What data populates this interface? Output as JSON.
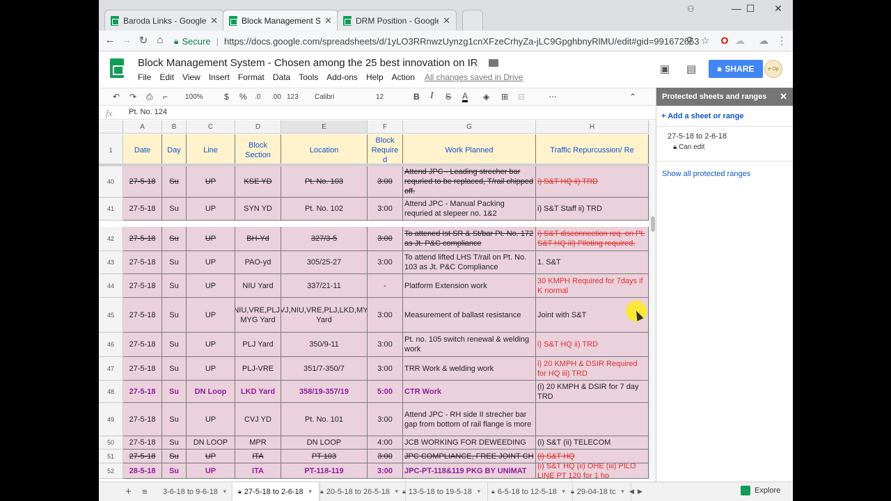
{
  "browser": {
    "tabs": [
      {
        "label": "Baroda Links - Google Sh",
        "active": false
      },
      {
        "label": "Block Management Syste",
        "active": true
      },
      {
        "label": "DRM Position - Google Sh",
        "active": false
      }
    ],
    "secure_label": "Secure",
    "url": "https://docs.google.com/spreadsheets/d/1yLO3RRnwzUynzg1cnXFzeCrhyZa-jLC9GpghbnyRlMU/edit#gid=991672653",
    "accent": "#4285f4"
  },
  "doc": {
    "title": "Block Management System - Chosen among the 25 best innovation on IR",
    "menu": [
      "File",
      "Edit",
      "View",
      "Insert",
      "Format",
      "Data",
      "Tools",
      "Add-ons",
      "Help",
      "Action"
    ],
    "saved_status": "All changes saved in Drive",
    "share_label": "SHARE",
    "avatar_text": "e-Op"
  },
  "format_toolbar": {
    "zoom": "100%",
    "currency": "$",
    "percent": "%",
    "dec_less": ".0",
    "dec_more": ".00",
    "number_format": "123",
    "font": "Calibri",
    "font_size": "12"
  },
  "formula_bar": {
    "value": "Pt. No. 124"
  },
  "columns": [
    "A",
    "B",
    "C",
    "D",
    "E",
    "F",
    "G",
    "H"
  ],
  "header_row": {
    "number": "1",
    "cells": [
      "Date",
      "Day",
      "Line",
      "Block Section",
      "Location",
      "Block Require d",
      "Work Planned",
      "Traffic Repurcussion/ Re"
    ]
  },
  "rows": [
    {
      "num": "40",
      "style": "strike",
      "cells": [
        "27-5-18",
        "Su",
        "UP",
        "KSE YD",
        "Pt. No. 103",
        "3:00",
        "Attend JPC - Leading strecher bar requried to be replaced, T/rail chipped off.",
        "i) S&T HQ ii) TRD"
      ]
    },
    {
      "num": "41",
      "style": "",
      "cells": [
        "27-5-18",
        "Su",
        "UP",
        "SYN YD",
        "Pt. No. 102",
        "3:00",
        "Attend JPC - Manual Packing requried at slepeer no. 1&2",
        "i) S&T Staff ii) TRD"
      ]
    },
    {
      "num": "42",
      "style": "strike",
      "cells": [
        "27-5-18",
        "Su",
        "UP",
        "BH-Yd",
        "327/3-5",
        "3:00",
        "To attened Ist SR & St/bar Pt. No. 172 as Jt. P&C compliance",
        "i) S&T disconnection req. on Pt. S&T HQ iii) Piloting required."
      ]
    },
    {
      "num": "43",
      "style": "",
      "cells": [
        "27-5-18",
        "Su",
        "UP",
        "PAO-yd",
        "305/25-27",
        "3:00",
        "To attend lifted LHS T/rail on Pt. No. 103 as Jt. P&C Compliance",
        "1. S&T"
      ]
    },
    {
      "num": "44",
      "style": "",
      "cells": [
        "27-5-18",
        "Su",
        "UP",
        "NIU Yard",
        "337/21-11",
        "-",
        "Platform Extension work",
        "30 KMPH Required for 7days if K normal"
      ]
    },
    {
      "num": "45",
      "style": "",
      "cells": [
        "27-5-18",
        "Su",
        "UP",
        "CVJ,NIU,VRE,PLJ,LKD, MYG Yard",
        "CVJ,NIU,VRE,PLJ,LKD,MYG Yard",
        "3:00",
        "Measurement of ballast resistance",
        "Joint with S&T"
      ]
    },
    {
      "num": "46",
      "style": "",
      "cells": [
        "27-5-18",
        "Su",
        "UP",
        "PLJ Yard",
        "350/9-11",
        "3:00",
        "Pt. no. 105 switch renewal & welding work",
        "i) S&T HQ ii) TRD"
      ]
    },
    {
      "num": "47",
      "style": "",
      "cells": [
        "27-5-18",
        "Su",
        "UP",
        "PLJ-VRE",
        "351/7-350/7",
        "3:00",
        "TRR Work & welding work",
        "i) 20 KMPH & DSIR Required for HQ iii) TRD"
      ]
    },
    {
      "num": "48",
      "style": "purple",
      "cells": [
        "27-5-18",
        "Su",
        "DN Loop",
        "LKD Yard",
        "358/19-357/19",
        "5:00",
        "CTR Work",
        "(i) 20 KMPH & DSIR for 7 day TRD"
      ]
    },
    {
      "num": "49",
      "style": "",
      "cells": [
        "27-5-18",
        "Su",
        "UP",
        "CVJ YD",
        "Pt. No. 101",
        "3:00",
        "Attend JPC - RH side II strecher bar gap from bottom of rail flange is more",
        ""
      ]
    },
    {
      "num": "50",
      "style": "",
      "cells": [
        "27-5-18",
        "Su",
        "DN LOOP",
        "MPR",
        "DN LOOP",
        "4:00",
        "JCB WORKING FOR DEWEEDING",
        "(i) S&T (ii) TELECOM"
      ]
    },
    {
      "num": "51",
      "style": "strike",
      "cells": [
        "27-5-18",
        "Su",
        "UP",
        "ITA",
        "PT 103",
        "3:00",
        "JPC COMPLIANCE, FREE JOINT CH",
        "(i) S&T HQ"
      ]
    },
    {
      "num": "52",
      "style": "purple",
      "cells": [
        "28-5-18",
        "Su",
        "UP",
        "ITA",
        "PT-118-119",
        "3:00",
        "JPC-PT-118&119 PKG BY UNIMAT",
        "(i) S&T HQ (ii) OHE (iii) PILO LINE PT 120 for 1 ho"
      ]
    }
  ],
  "sheet_tabs": [
    {
      "label": "3-6-18 to 9-6-18",
      "locked": false,
      "active": false
    },
    {
      "label": "27-5-18 to 2-6-18",
      "locked": true,
      "active": true
    },
    {
      "label": "20-5-18 to 26-5-18",
      "locked": true,
      "active": false
    },
    {
      "label": "13-5-18 to 19-5-18",
      "locked": true,
      "active": false
    },
    {
      "label": "6-5-18 to 12-5-18",
      "locked": true,
      "active": false
    },
    {
      "label": "29-04-18 tc",
      "locked": true,
      "active": false
    }
  ],
  "explore_label": "Explore",
  "panel": {
    "title": "Protected sheets and ranges",
    "add_label": "+ Add a sheet or range",
    "item_range": "27-5-18 to 2-6-18",
    "item_perm": "Can edit",
    "show_all": "Show all protected ranges"
  },
  "colors": {
    "row_fill": "#ead1dc",
    "header_fill": "#fff2cc",
    "header_text": "#1155cc",
    "red_text": "#e0302a",
    "purple_text": "#8e1d9c"
  }
}
